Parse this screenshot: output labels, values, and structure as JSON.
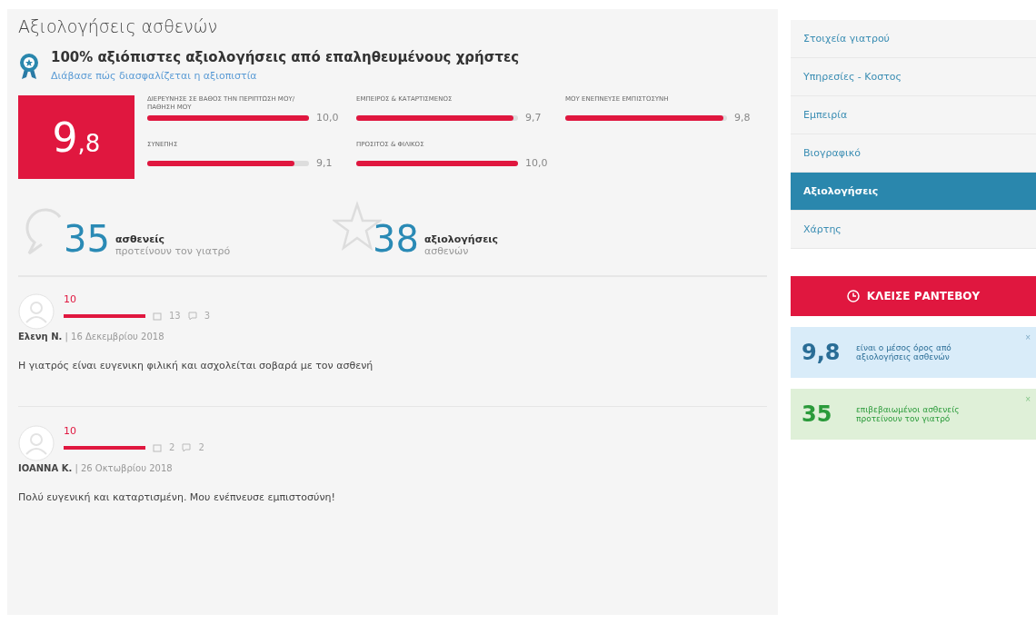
{
  "title": "Αξιολογήσεις ασθενών",
  "trust": {
    "heading": "100% αξιόπιστες αξιολογήσεις από επαληθευμένους χρήστες",
    "link": "Διάβασε πώς διασφαλίζεται η αξιοπιστία"
  },
  "score": {
    "integer": "9",
    "decimal": ",8"
  },
  "criteria": [
    {
      "label": "ΔΙΕΡΕΥΝΗΣΕ ΣΕ ΒΑΘΟΣ ΤΗΝ ΠΕΡΙΠΤΩΣΗ ΜΟΥ/ΠΑΘΗΣΗ ΜΟΥ",
      "level": 1.0,
      "value": "10,0"
    },
    {
      "label": "ΕΜΠΕΙΡΟΣ & ΚΑΤΑΡΤΙΣΜΕΝΟΣ",
      "level": 0.97,
      "value": "9,7"
    },
    {
      "label": "ΜΟΥ ΕΝΕΠΝΕΥΣΕ ΕΜΠΙΣΤΟΣΥΝΗ",
      "level": 0.98,
      "value": "9,8"
    },
    {
      "label": "ΣΥΝΕΠΗΣ",
      "level": 0.91,
      "value": "9,1"
    },
    {
      "label": "ΠΡΟΣΙΤΟΣ & ΦΙΛΙΚΟΣ",
      "level": 1.0,
      "value": "10,0"
    }
  ],
  "stats": [
    {
      "kind": "recommend",
      "number": "35",
      "label": "ασθενείς",
      "sublabel": "προτείνουν τον γιατρό"
    },
    {
      "kind": "reviews",
      "number": "38",
      "label": "αξιολογήσεις",
      "sublabel": "ασθενών"
    }
  ],
  "reviews": [
    {
      "score": "10",
      "level": 1.0,
      "dates": "13",
      "comments": "3",
      "author": "Ελενη Ν.",
      "date": "| 16 Δεκεμβρίου 2018",
      "text": "Η γιατρός είναι ευγενικη φιλική και ασχολείται σοβαρά με τον ασθενή"
    },
    {
      "score": "10",
      "level": 1.0,
      "dates": "2",
      "comments": "2",
      "author": "IOANNA K.",
      "date": "| 26 Οκτωβρίου 2018",
      "text": "Πολύ ευγενική και καταρτισμένη. Μου ενέπνευσε εμπιστοσύνη!"
    }
  ],
  "sidebar": {
    "items": [
      {
        "label": "Στοιχεία γιατρού",
        "selected": false
      },
      {
        "label": "Υπηρεσίες - Κοστος",
        "selected": false
      },
      {
        "label": "Εμπειρία",
        "selected": false
      },
      {
        "label": "Βιογραφικό",
        "selected": false
      },
      {
        "label": "Αξιολογήσεις",
        "selected": true
      },
      {
        "label": "Χάρτης",
        "selected": false
      }
    ]
  },
  "book_button": "ΚΛΕΙΣΕ ΡΑΝΤΕΒΟΥ",
  "info_boxes": [
    {
      "kind": "info",
      "number": "9,8",
      "text": "είναι ο μέσος όρος από αξιολογήσεις ασθενών",
      "close": "×"
    },
    {
      "kind": "success",
      "number": "35",
      "text": "επιβεβαιωμένοι ασθενείς προτείνουν τον γιατρό",
      "close": "×"
    }
  ]
}
